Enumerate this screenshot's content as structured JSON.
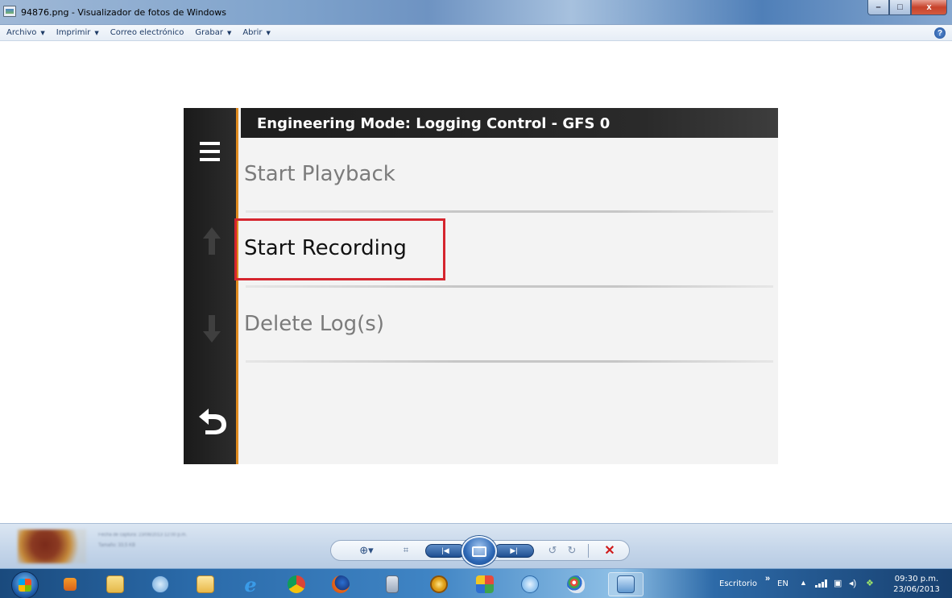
{
  "window": {
    "title": "94876.png - Visualizador de fotos de Windows",
    "minimize_glyph": "–",
    "maximize_glyph": "□",
    "close_glyph": "x"
  },
  "menubar": {
    "items": [
      {
        "label": "Archivo",
        "has_dropdown": true
      },
      {
        "label": "Imprimir",
        "has_dropdown": true
      },
      {
        "label": "Correo electrónico",
        "has_dropdown": false
      },
      {
        "label": "Grabar",
        "has_dropdown": true
      },
      {
        "label": "Abrir",
        "has_dropdown": true
      }
    ],
    "help_glyph": "?"
  },
  "device": {
    "header_title": "Engineering Mode: Logging Control - GFS 0",
    "accent_color": "#e08b1f",
    "sidebar_icons": [
      "menu-icon",
      "up-arrow-icon",
      "down-arrow-icon",
      "back-icon"
    ],
    "menu_items": [
      {
        "label": "Start Playback",
        "enabled": false
      },
      {
        "label": "Start Recording",
        "enabled": true,
        "highlighted": true
      },
      {
        "label": "Delete Log(s)",
        "enabled": false
      }
    ],
    "highlight_color": "#d5252e"
  },
  "controlbar": {
    "blurred_line_1": "Fecha de captura: 23/06/2013 12:00 p.m.",
    "blurred_line_2": "Tamaño: 33,5 KB",
    "icons": [
      "zoom-icon",
      "fit-window-icon",
      "previous-icon",
      "slideshow-icon",
      "next-icon",
      "rotate-left-icon",
      "rotate-right-icon",
      "delete-icon"
    ]
  },
  "taskbar": {
    "desktop_label": "Escritorio",
    "chevron": "»",
    "language": "EN",
    "time": "09:30 p.m.",
    "date": "23/06/2013",
    "pinned_apps": [
      "media-player-icon",
      "explorer-icon",
      "network-icon",
      "mail-icon",
      "internet-explorer-icon",
      "chrome-icon",
      "firefox-icon",
      "calculator-icon",
      "app-icon",
      "paint-palette-icon",
      "gem-icon",
      "paint-icon",
      "photo-viewer-icon"
    ]
  }
}
